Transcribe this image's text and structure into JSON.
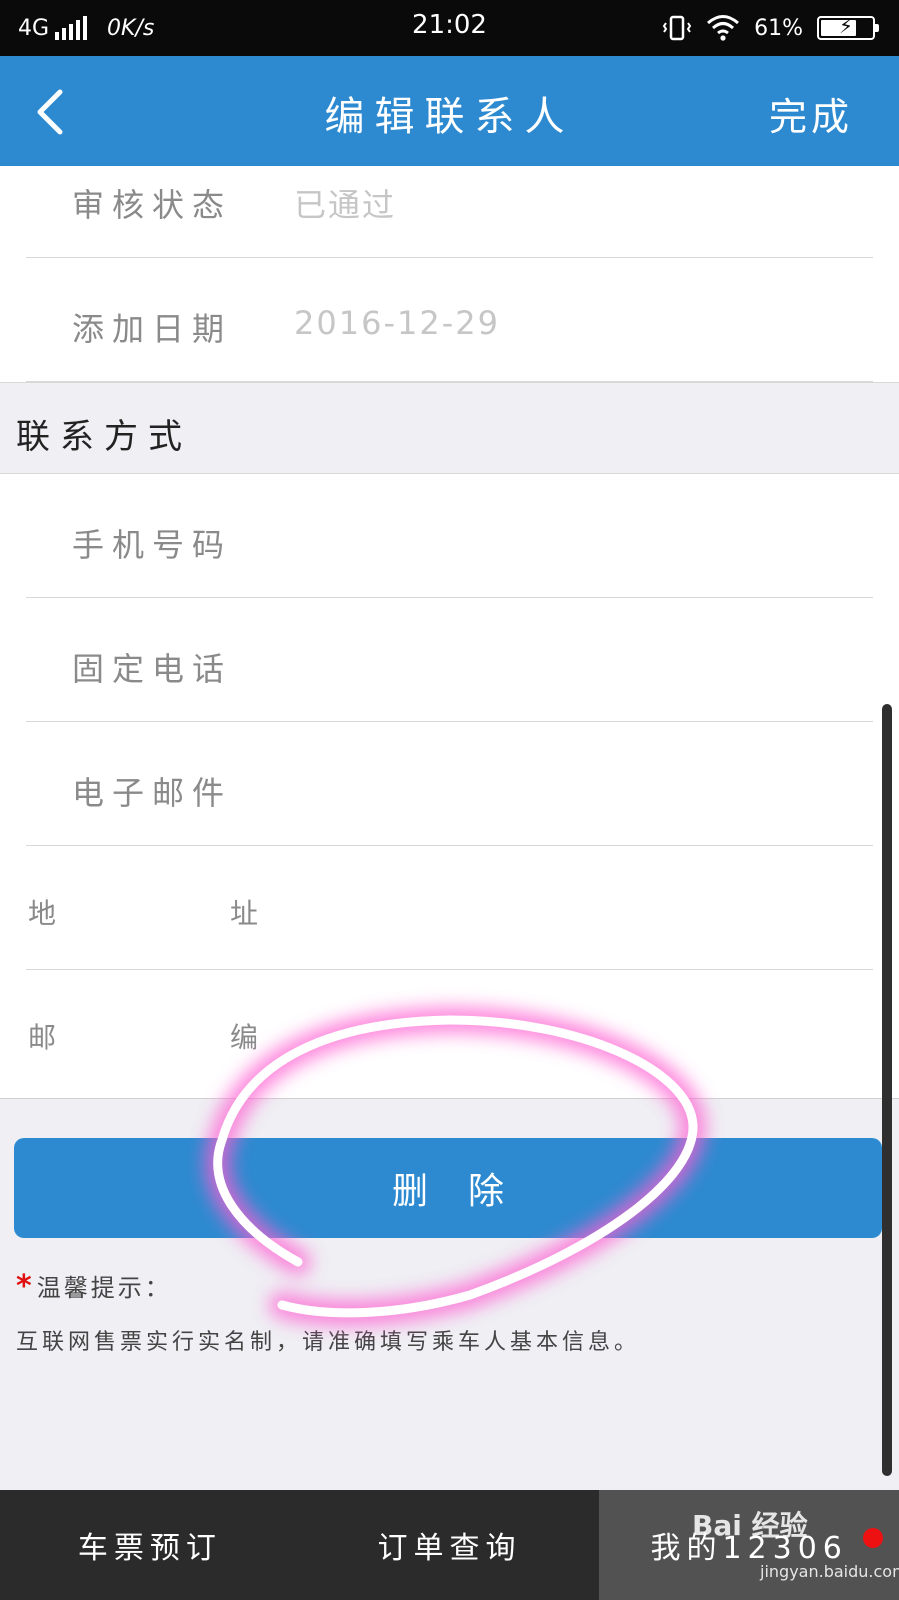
{
  "status_bar": {
    "network": "4G",
    "speed": "0K/s",
    "time": "21:02",
    "battery": "61%"
  },
  "nav": {
    "back_icon": "chevron-left-icon",
    "title": "编辑联系人",
    "done": "完成"
  },
  "info_rows": [
    {
      "label": "审核状态",
      "value": "已通过"
    },
    {
      "label": "添加日期",
      "value": "2016-12-29"
    }
  ],
  "contact_section": {
    "title": "联系方式",
    "rows": [
      {
        "label": "手机号码"
      },
      {
        "label": "固定电话"
      },
      {
        "label": "电子邮件"
      },
      {
        "label_a": "地",
        "label_b": "址"
      },
      {
        "label_a": "邮",
        "label_b": "编"
      }
    ]
  },
  "delete_button": "删除",
  "tip": {
    "title": "温馨提示：",
    "body": "互联网售票实行实名制，请准确填写乘车人基本信息。"
  },
  "tabs": [
    {
      "label": "车票预订"
    },
    {
      "label": "订单查询"
    },
    {
      "label": "我的12306",
      "active": true
    }
  ],
  "watermark": {
    "brand": "Bai 经验",
    "url": "jingyan.baidu.com"
  },
  "colors": {
    "primary": "#2d8ad0",
    "status_bar_bg": "#0a0a0a",
    "tab_bar_bg": "#2b2b2b",
    "tab_active_bg": "#525252",
    "page_bg": "#efeff4",
    "badge": "#ee1111",
    "annotation_glow": "#ff5fd2"
  }
}
